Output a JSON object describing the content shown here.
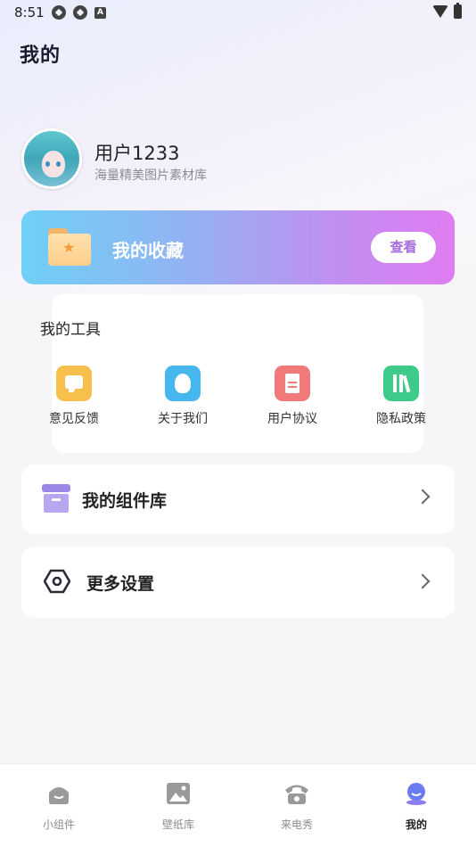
{
  "status_bar": {
    "time": "8:51",
    "a_icon": "A"
  },
  "page": {
    "title": "我的"
  },
  "profile": {
    "username": "用户1233",
    "subtitle": "海量精美图片素材库"
  },
  "favorites": {
    "title": "我的收藏",
    "view_label": "查看",
    "gradient_colors": [
      "#6fd0f6",
      "#c38cf1",
      "#e07cf2"
    ]
  },
  "tools": {
    "title": "我的工具",
    "items": [
      {
        "label": "意见反馈",
        "icon": "feedback-chat-icon",
        "color": "#f7bf4b"
      },
      {
        "label": "关于我们",
        "icon": "people-icon",
        "color": "#45b6ee"
      },
      {
        "label": "用户协议",
        "icon": "document-icon",
        "color": "#f07a7a"
      },
      {
        "label": "隐私政策",
        "icon": "books-icon",
        "color": "#3ecb8a"
      }
    ]
  },
  "rows": [
    {
      "label": "我的组件库",
      "icon": "widget-box-icon"
    },
    {
      "label": "更多设置",
      "icon": "hexagon-settings-icon"
    }
  ],
  "bottom_nav": {
    "items": [
      {
        "label": "小组件",
        "icon": "widget-icon",
        "active": false
      },
      {
        "label": "壁纸库",
        "icon": "wallpaper-icon",
        "active": false
      },
      {
        "label": "来电秀",
        "icon": "phone-icon",
        "active": false
      },
      {
        "label": "我的",
        "icon": "profile-icon",
        "active": true
      }
    ]
  }
}
